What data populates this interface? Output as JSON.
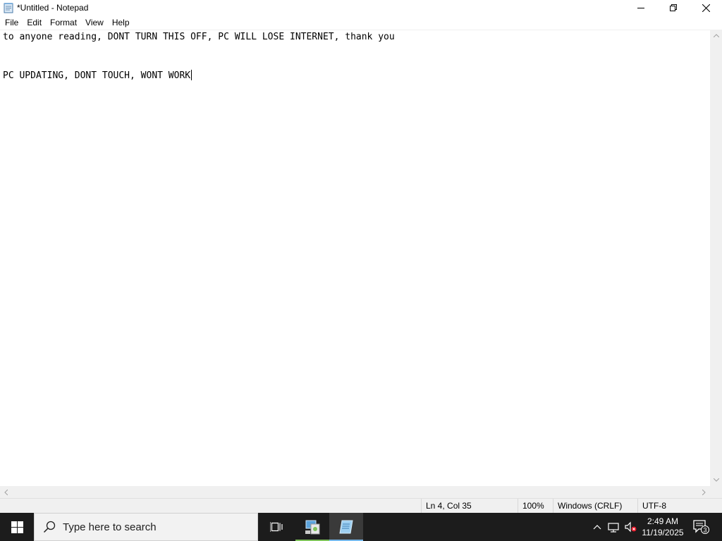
{
  "window": {
    "title": "*Untitled - Notepad"
  },
  "menu": {
    "items": [
      "File",
      "Edit",
      "Format",
      "View",
      "Help"
    ]
  },
  "editor": {
    "lines": [
      "to anyone reading, DONT TURN THIS OFF, PC WILL LOSE INTERNET, thank you",
      "",
      "",
      "PC UPDATING, DONT TOUCH, WONT WORK"
    ]
  },
  "statusbar": {
    "position": "Ln 4, Col 35",
    "zoom": "100%",
    "line_ending": "Windows (CRLF)",
    "encoding": "UTF-8"
  },
  "taskbar": {
    "search_placeholder": "Type here to search",
    "clock_time": "2:49 AM",
    "clock_date": "11/19/2025",
    "notification_count": "3",
    "accent_color": "#7fc35a",
    "active_indicator_color": "#76b9ed"
  },
  "icons": {
    "app": "notepad-icon",
    "minimize": "minimize-icon",
    "maximize": "restore-icon",
    "close": "close-icon",
    "start": "windows-logo-icon",
    "search": "search-icon",
    "task_view": "task-view-icon",
    "network": "network-icon",
    "volume": "volume-muted-icon",
    "chevron": "chevron-up-icon",
    "notifications": "action-center-icon"
  }
}
